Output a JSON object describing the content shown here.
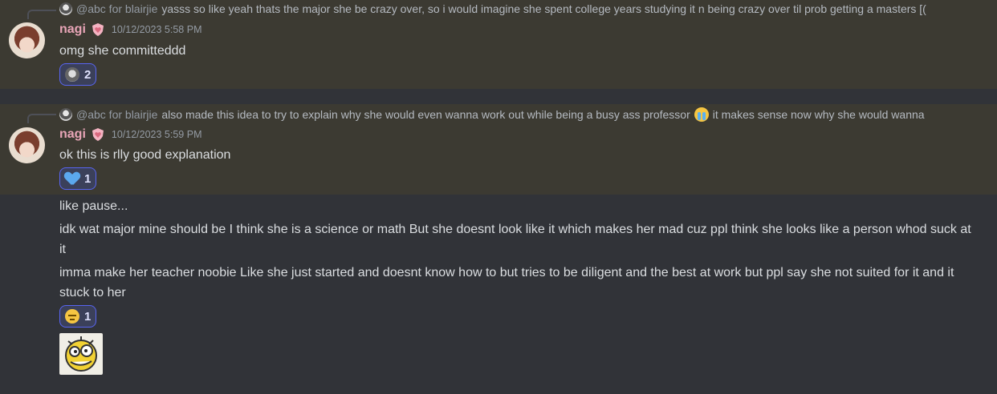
{
  "messages": [
    {
      "reply": {
        "name": "@abc for blairjie",
        "text": "yasss so like yeah thats the major she be crazy over, so i would imagine she spent college years studying it n being crazy over til prob getting a masters [("
      },
      "author": "nagi",
      "role_icon": "shield-heart-icon",
      "timestamp": "10/12/2023 5:58 PM",
      "content": "omg she committeddd",
      "reaction": {
        "emoji": "custom-emoji",
        "count": "2"
      }
    },
    {
      "reply": {
        "name": "@abc for blairjie",
        "text_before": "also made this idea to try to explain why she would even wanna work out while being a busy ass professor",
        "emoji": "sob-emoji",
        "text_after": "it makes sense now why she would wanna"
      },
      "author": "nagi",
      "role_icon": "shield-heart-icon",
      "timestamp": "10/12/2023 5:59 PM",
      "content": "ok this is rlly good explanation",
      "reaction": {
        "emoji": "blue-heart-emoji",
        "count": "1"
      }
    }
  ],
  "followups": [
    "like pause...",
    "idk wat major mine should be I think she is a science or math But she doesnt look like it which makes her mad cuz ppl think she looks like a person whod suck at it",
    "imma make her teacher noobie Like she just started and doesnt know how to but tries to be diligent and the best at work but ppl say she not suited for it and it stuck to her"
  ],
  "followup_reaction": {
    "emoji": "pensive-emoji",
    "count": "1"
  },
  "sticker": "dizzy-face-sticker",
  "colors": {
    "background": "#313338",
    "highlight": "#3c3a32",
    "username": "#e8a5b7",
    "reaction_border": "#5865f2"
  }
}
